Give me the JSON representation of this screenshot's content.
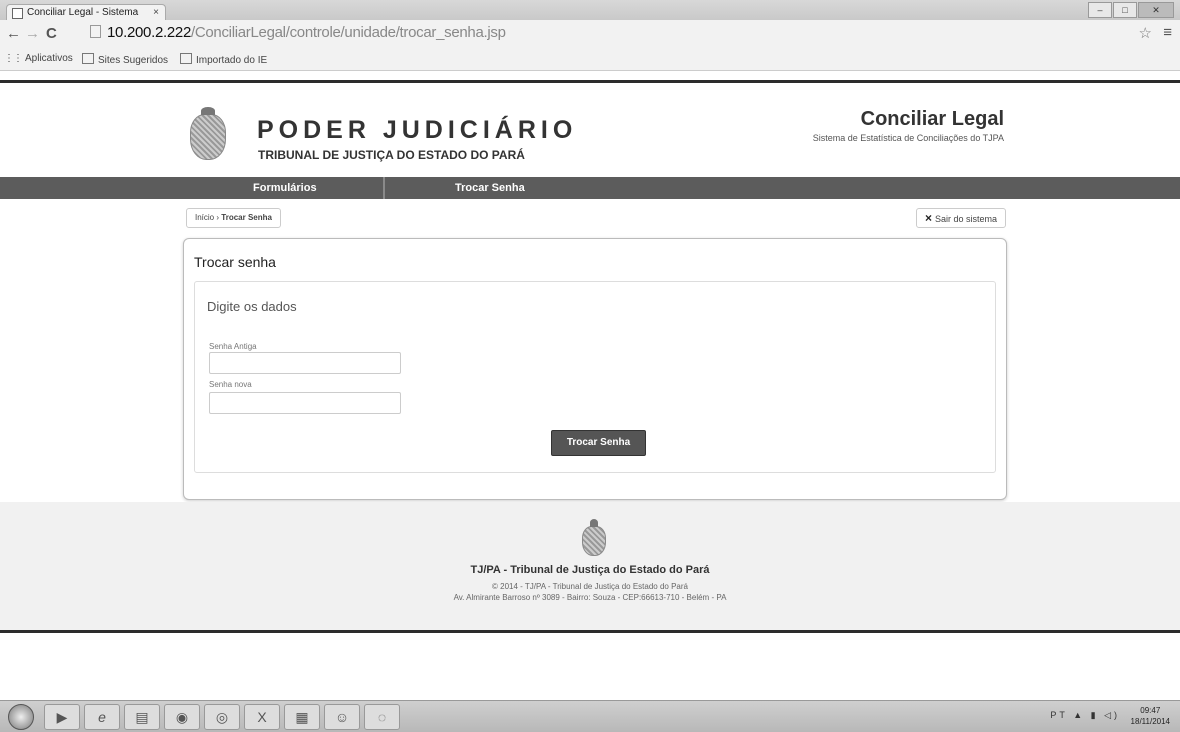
{
  "browser": {
    "tab_title": "Conciliar Legal - Sistema",
    "tab_close": "×",
    "url_host": "10.200.2.222",
    "url_path": "/ConciliarLegal/controle/unidade/trocar_senha.jsp",
    "bookmarks": [
      "Aplicativos",
      "Sites Sugeridos",
      "Importado do IE"
    ]
  },
  "header": {
    "org_title": "PODER JUDICIÁRIO",
    "org_subtitle": "TRIBUNAL DE JUSTIÇA DO ESTADO DO PARÁ",
    "app_title": "Conciliar Legal",
    "app_subtitle": "Sistema de Estatística de Conciliações do TJPA"
  },
  "nav": {
    "items": [
      "Formulários",
      "Trocar Senha"
    ]
  },
  "breadcrumb": {
    "home": "Início",
    "separator": "›",
    "current": "Trocar Senha"
  },
  "logout": {
    "icon": "×",
    "label": "Sair do sistema"
  },
  "form": {
    "title": "Trocar senha",
    "legend": "Digite os dados",
    "old_password_label": "Senha Antiga",
    "new_password_label": "Senha nova",
    "submit_label": "Trocar Senha"
  },
  "footer": {
    "title": "TJ/PA - Tribunal de Justiça do Estado do Pará",
    "copyright": "© 2014 - TJ/PA - Tribunal de Justiça do Estado do Pará",
    "address": "Av. Almirante Barroso nº 3089 - Bairro: Souza - CEP:66613-710 - Belém - PA"
  },
  "taskbar": {
    "clock_time": "09:47",
    "clock_date": "18/11/2014",
    "tray_lang": "PT"
  }
}
